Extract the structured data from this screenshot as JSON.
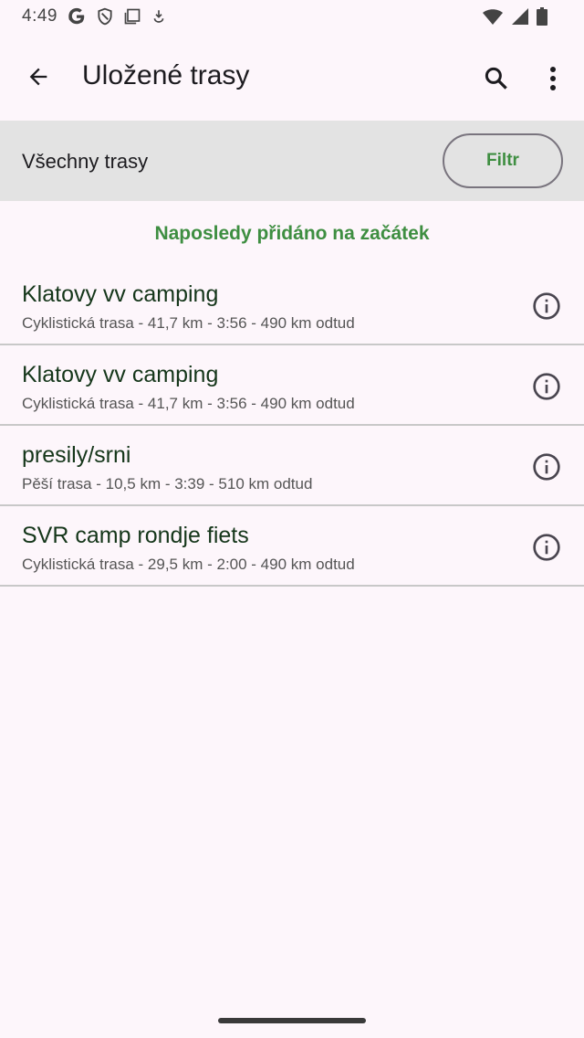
{
  "status_bar": {
    "time": "4:49",
    "icons": [
      "google-icon",
      "shield-icon",
      "screen-icon",
      "download-icon",
      "wifi-icon",
      "signal-icon",
      "battery-icon"
    ]
  },
  "app_bar": {
    "title": "Uložené trasy",
    "icons": [
      "back-arrow-icon",
      "search-icon",
      "more-vert-icon"
    ]
  },
  "filter_bar": {
    "label": "Všechny trasy",
    "filter_button": "Filtr"
  },
  "sort_label": "Naposledy přidáno na začátek",
  "routes": [
    {
      "name": "Klatovy vv camping",
      "details": "Cyklistická trasa - 41,7 km - 3:56 - 490 km odtud"
    },
    {
      "name": "Klatovy vv camping",
      "details": "Cyklistická trasa - 41,7 km - 3:56 - 490 km odtud"
    },
    {
      "name": "presily/srni",
      "details": "Pěší trasa - 10,5 km - 3:39 - 510 km odtud"
    },
    {
      "name": "SVR camp rondje fiets",
      "details": "Cyklistická trasa - 29,5 km - 2:00 - 490 km odtud"
    }
  ],
  "colors": {
    "accent": "#3e8e41",
    "background": "#fdf6fb",
    "filter_bar": "#e3e3e3",
    "route_name": "#15361a"
  }
}
